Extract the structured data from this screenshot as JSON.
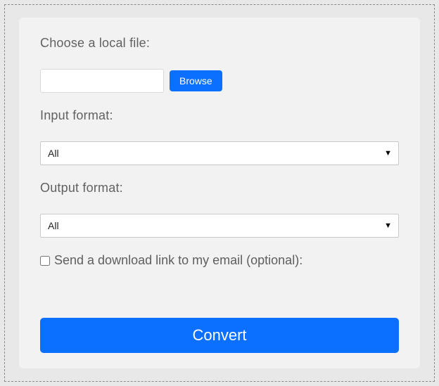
{
  "labels": {
    "choose_file": "Choose a local file:",
    "input_format": "Input format:",
    "output_format": "Output format:",
    "email_optional": "Send a download link to my email (optional):"
  },
  "file_input": {
    "value": "",
    "placeholder": ""
  },
  "browse_button": "Browse",
  "input_format_select": {
    "selected": "All"
  },
  "output_format_select": {
    "selected": "All"
  },
  "email_checkbox": {
    "checked": false
  },
  "convert_button": "Convert"
}
